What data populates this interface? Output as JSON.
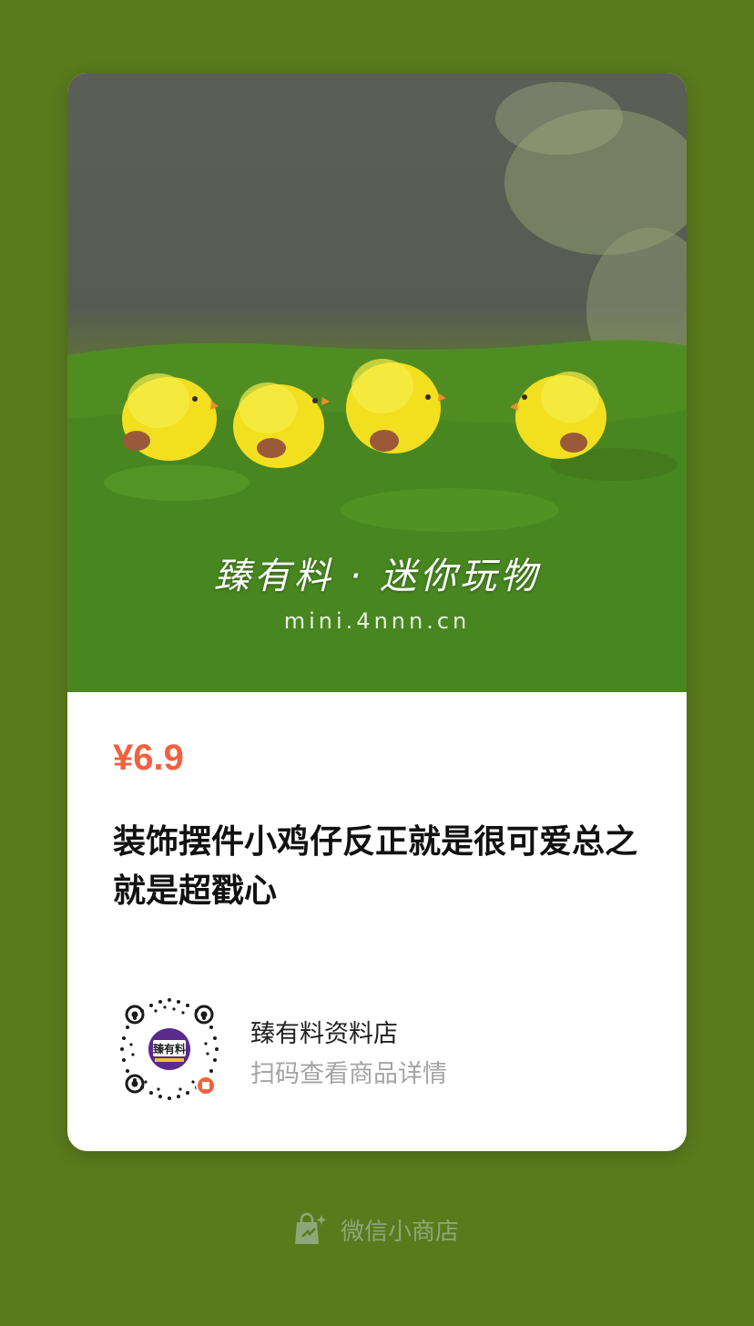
{
  "product": {
    "price": "¥6.9",
    "title": "装饰摆件小鸡仔反正就是很可爱总之就是超戳心",
    "image_watermark_brand": "臻有料 · 迷你玩物",
    "image_watermark_url": "mini.4nnn.cn"
  },
  "shop": {
    "qr_logo_text": "臻有料",
    "name": "臻有料资料店",
    "hint": "扫码查看商品详情"
  },
  "footer": {
    "label": "微信小商店",
    "icon": "shopping-bag-icon"
  },
  "colors": {
    "background": "#5a7a1c",
    "price": "#f2613d",
    "footer_text": "#8ea77a"
  }
}
